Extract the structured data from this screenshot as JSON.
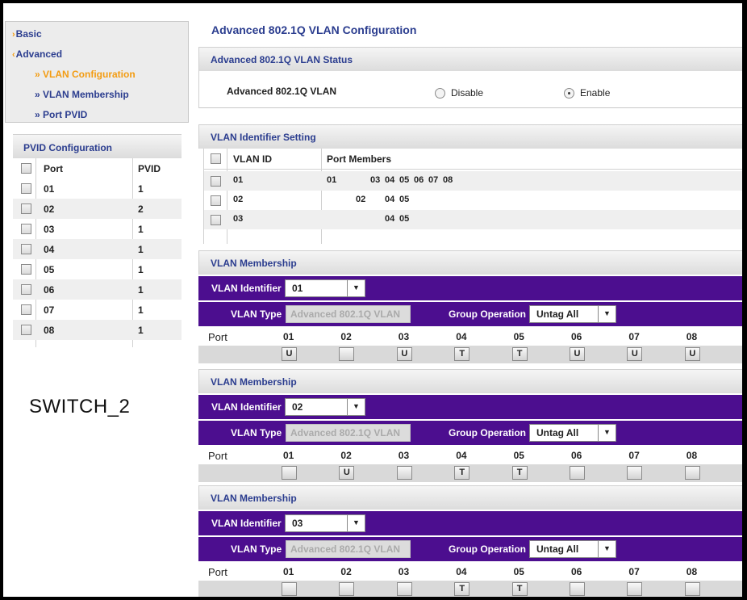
{
  "nav": {
    "items": [
      {
        "label": "Basic",
        "mark": "›"
      },
      {
        "label": "Advanced",
        "mark": "‹"
      },
      {
        "label": "» VLAN Configuration"
      },
      {
        "label": "» VLAN Membership"
      },
      {
        "label": "» Port PVID"
      }
    ]
  },
  "pvid": {
    "title": "PVID Configuration",
    "headers": [
      "Port",
      "PVID"
    ],
    "rows": [
      [
        "01",
        "1"
      ],
      [
        "02",
        "2"
      ],
      [
        "03",
        "1"
      ],
      [
        "04",
        "1"
      ],
      [
        "05",
        "1"
      ],
      [
        "06",
        "1"
      ],
      [
        "07",
        "1"
      ],
      [
        "08",
        "1"
      ]
    ]
  },
  "page_title": "Advanced 802.1Q VLAN Configuration",
  "status": {
    "title": "Advanced 802.1Q VLAN Status",
    "label": "Advanced 802.1Q VLAN",
    "disable": "Disable",
    "enable": "Enable",
    "selected": "Enable"
  },
  "vid_setting": {
    "title": "VLAN Identifier Setting",
    "headers": [
      "VLAN ID",
      "Port Members"
    ],
    "rows": [
      {
        "id": "01",
        "members": [
          "01",
          "",
          "03",
          "04",
          "05",
          "06",
          "07",
          "08"
        ]
      },
      {
        "id": "02",
        "members": [
          "",
          "02",
          "",
          "04",
          "05",
          "",
          "",
          ""
        ]
      },
      {
        "id": "03",
        "members": [
          "",
          "",
          "",
          "04",
          "05",
          "",
          "",
          ""
        ]
      }
    ]
  },
  "membership_common": {
    "title": "VLAN Membership",
    "vid_label": "VLAN Identifier",
    "type_label": "VLAN Type",
    "type_value": "Advanced 802.1Q VLAN",
    "group_label": "Group Operation",
    "group_value": "Untag All",
    "port_label": "Port",
    "ports": [
      "01",
      "02",
      "03",
      "04",
      "05",
      "06",
      "07",
      "08"
    ]
  },
  "memberships": [
    {
      "vid": "01",
      "states": [
        "U",
        "",
        "U",
        "T",
        "T",
        "U",
        "U",
        "U"
      ]
    },
    {
      "vid": "02",
      "states": [
        "",
        "U",
        "",
        "T",
        "T",
        "",
        "",
        ""
      ]
    },
    {
      "vid": "03",
      "states": [
        "",
        "",
        "",
        "T",
        "T",
        "",
        "",
        ""
      ]
    }
  ],
  "switch_label": "SWITCH_2"
}
